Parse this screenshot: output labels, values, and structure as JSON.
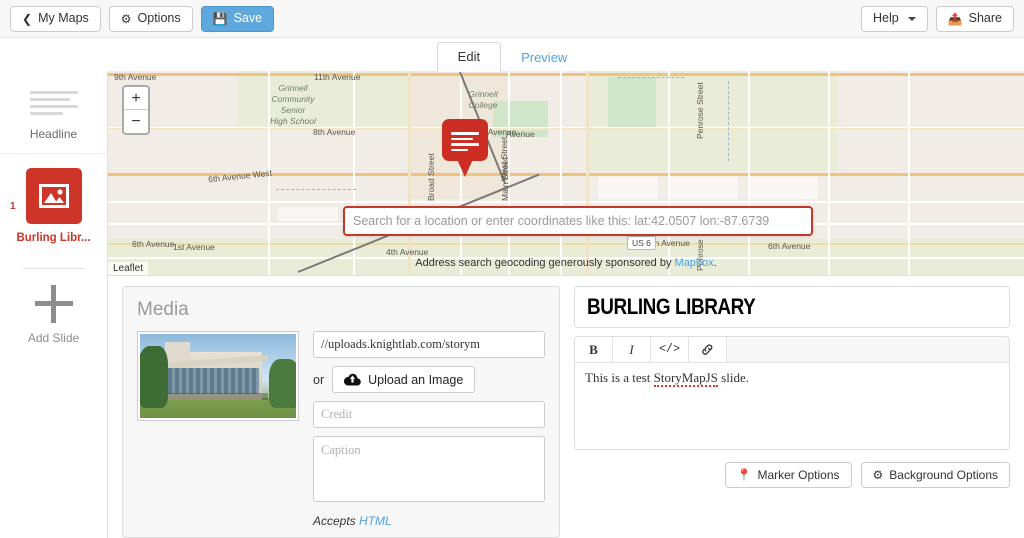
{
  "topbar": {
    "my_maps": "My Maps",
    "options": "Options",
    "save": "Save",
    "help": "Help",
    "share": "Share"
  },
  "tabs": [
    {
      "label": "Edit",
      "active": true
    },
    {
      "label": "Preview",
      "active": false
    }
  ],
  "sidebar": {
    "headline_label": "Headline",
    "slide": {
      "number": "1",
      "label": "Burling Libr..."
    },
    "add_slide_label": "Add Slide"
  },
  "map": {
    "zoom_in": "+",
    "zoom_out": "−",
    "attribution": "Leaflet",
    "search_placeholder": "Search for a location or enter coordinates like this: lat:42.0507 lon:-87.6739",
    "search_value": "",
    "geocode_credit_prefix": "Address search geocoding generously sponsored by ",
    "geocode_credit_link": "Mapbox",
    "geocode_credit_suffix": ".",
    "labels": [
      "9th Avenue",
      "11th Avenue",
      "8th Avenue",
      "6th Avenue West",
      "6th Avenue",
      "380th Avenue",
      "1st Avenue",
      "4th Avenue",
      "Avenue",
      "Broad Street",
      "West Street",
      "Main Street",
      "Penrose Street",
      "Penrose",
      "Grinnell Community Senior High School",
      "Grinnell College",
      "US 6"
    ],
    "marker_color": "#cc2e24",
    "search_border_color": "#c0392b"
  },
  "media": {
    "title": "Media",
    "url_value": "//uploads.knightlab.com/storym",
    "or_label": "or",
    "upload_label": "Upload an Image",
    "credit_placeholder": "Credit",
    "credit_value": "",
    "caption_placeholder": "Caption",
    "caption_value": "",
    "accepts_prefix": "Accepts ",
    "accepts_link": "HTML"
  },
  "text": {
    "title": "BURLING LIBRARY",
    "toolbar": {
      "bold": "B",
      "italic": "I",
      "code": "</>",
      "link": "🔗"
    },
    "body_prefix": "This is a test ",
    "body_spell": "StoryMapJS",
    "body_suffix": " slide."
  },
  "footer": {
    "marker_options": "Marker Options",
    "background_options": "Background Options"
  }
}
